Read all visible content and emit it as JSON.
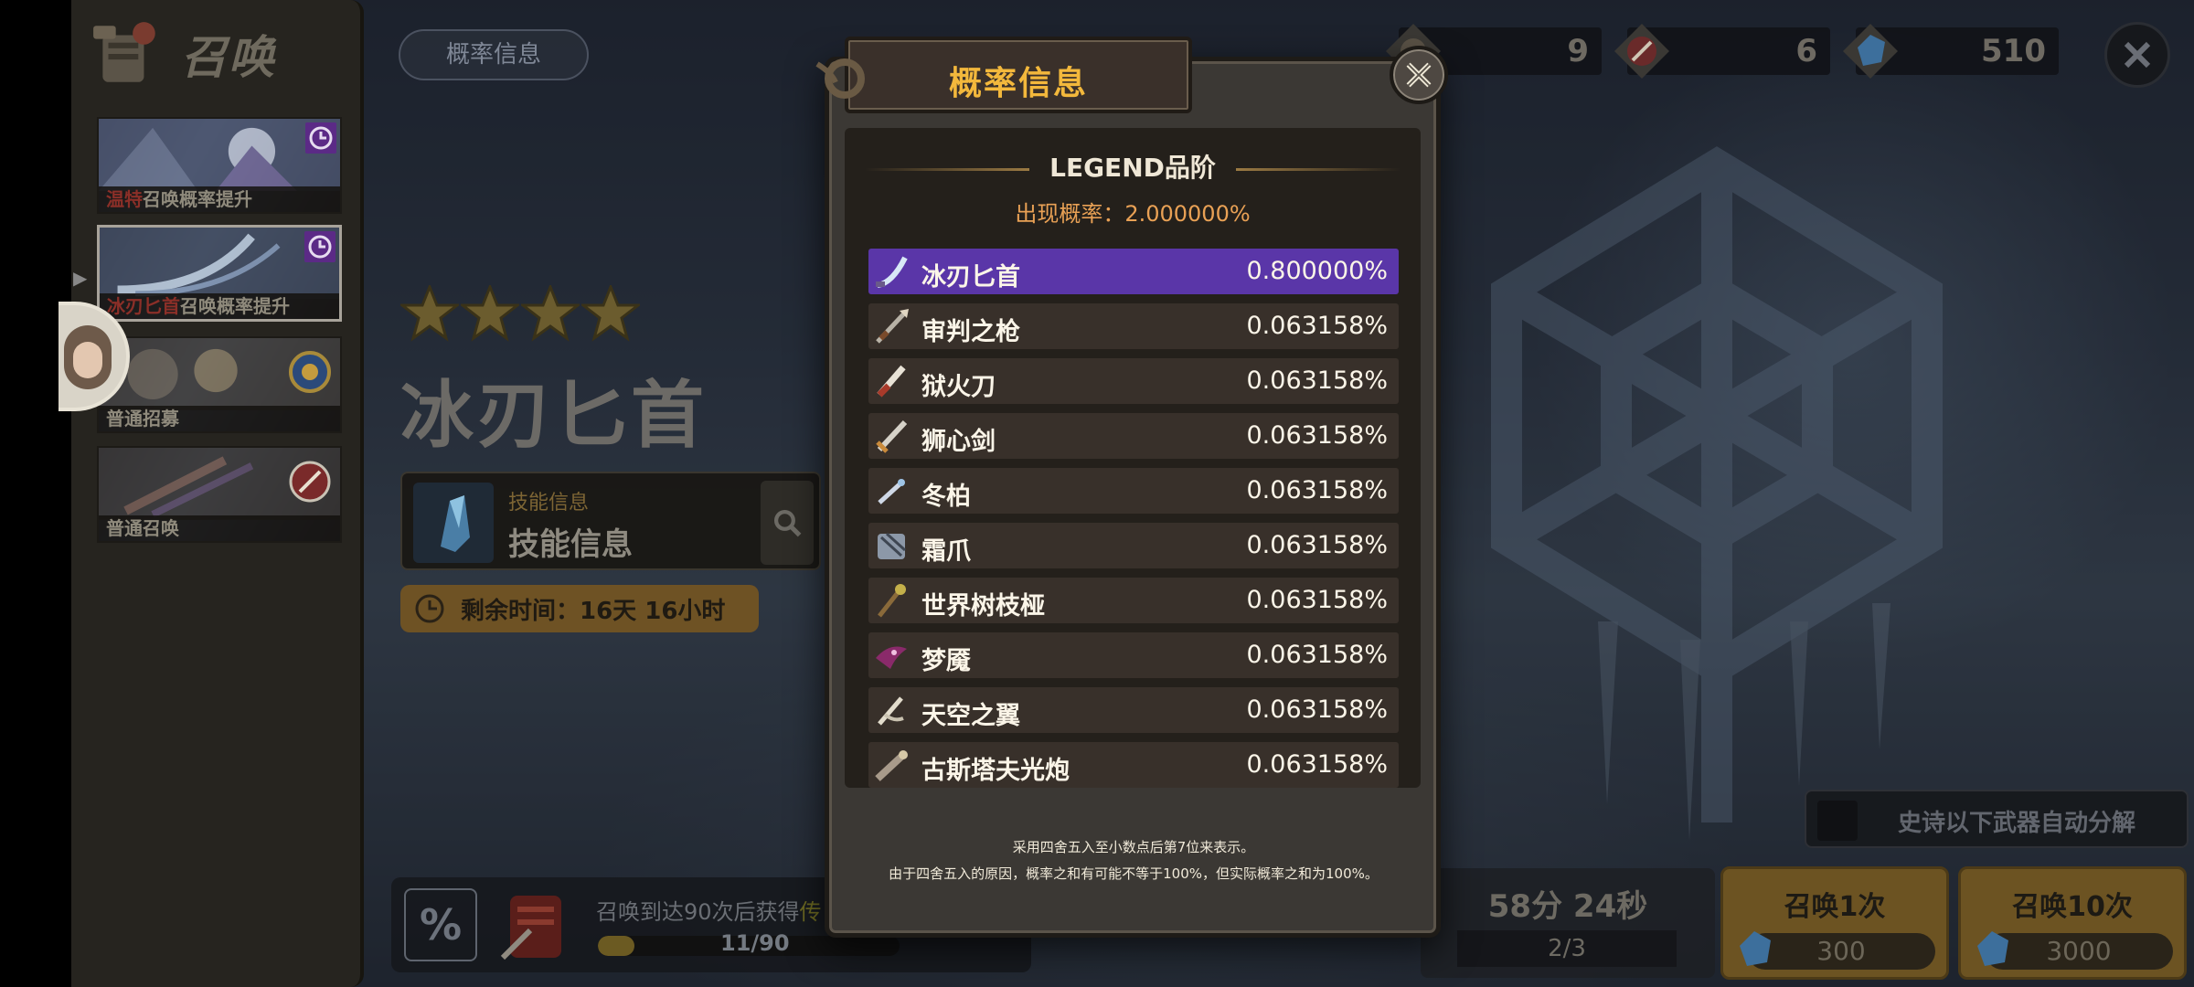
{
  "side_panel": {
    "title": "召唤",
    "banners": [
      {
        "highlight": "温特",
        "text": "召唤概率提升",
        "icon": "clock-icon"
      },
      {
        "highlight": "冰刃匕首",
        "text": "召唤概率提升",
        "icon": "clock-icon"
      },
      {
        "highlight": "",
        "text": "普通招募",
        "icon": "summon-badge-icon"
      },
      {
        "highlight": "",
        "text": "普通召唤",
        "icon": "weapon-badge-icon"
      }
    ]
  },
  "top": {
    "prob_info_button": "概率信息",
    "currencies": [
      {
        "icon": "ticket-icon",
        "value": "9"
      },
      {
        "icon": "sword-ticket-icon",
        "value": "6"
      },
      {
        "icon": "blue-gem-icon",
        "value": "510"
      }
    ]
  },
  "featured": {
    "stars": 4,
    "name": "冰刃匕首",
    "skill_small": "技能信息",
    "skill_big": "技能信息",
    "remaining_time": "剩余时间：16天 16小时"
  },
  "bottom": {
    "percent_icon": "%",
    "milestone_text_prefix": "召唤到达90次后获得",
    "milestone_text_highlight": "传",
    "progress_label": "11/90",
    "progress_fraction": 0.122,
    "timer": "58分 24秒",
    "timer_count": "2/3",
    "summon_1": {
      "label": "召唤1次",
      "cost": "300"
    },
    "summon_10": {
      "label": "召唤10次",
      "cost": "3000"
    },
    "auto_dismantle": "史诗以下武器自动分解"
  },
  "modal": {
    "title": "概率信息",
    "grade_title": "LEGEND品阶",
    "appear_rate": "出现概率：2.000000%",
    "items": [
      {
        "name": "冰刃匕首",
        "rate": "0.800000%",
        "icon": "ice-dagger-icon",
        "selected": true
      },
      {
        "name": "审判之枪",
        "rate": "0.063158%",
        "icon": "spear-icon"
      },
      {
        "name": "狱火刀",
        "rate": "0.063158%",
        "icon": "fire-blade-icon"
      },
      {
        "name": "狮心剑",
        "rate": "0.063158%",
        "icon": "sword-icon"
      },
      {
        "name": "冬柏",
        "rate": "0.063158%",
        "icon": "wand-icon"
      },
      {
        "name": "霜爪",
        "rate": "0.063158%",
        "icon": "claw-icon"
      },
      {
        "name": "世界树枝桠",
        "rate": "0.063158%",
        "icon": "staff-icon"
      },
      {
        "name": "梦魇",
        "rate": "0.063158%",
        "icon": "nightmare-icon"
      },
      {
        "name": "天空之翼",
        "rate": "0.063158%",
        "icon": "wing-icon"
      },
      {
        "name": "古斯塔夫光炮",
        "rate": "0.063158%",
        "icon": "cannon-icon"
      }
    ],
    "note_1": "采用四舍五入至小数点后第7位来表示。",
    "note_2": "由于四舍五入的原因，概率之和有可能不等于100%，但实际概率之和为100%。"
  }
}
